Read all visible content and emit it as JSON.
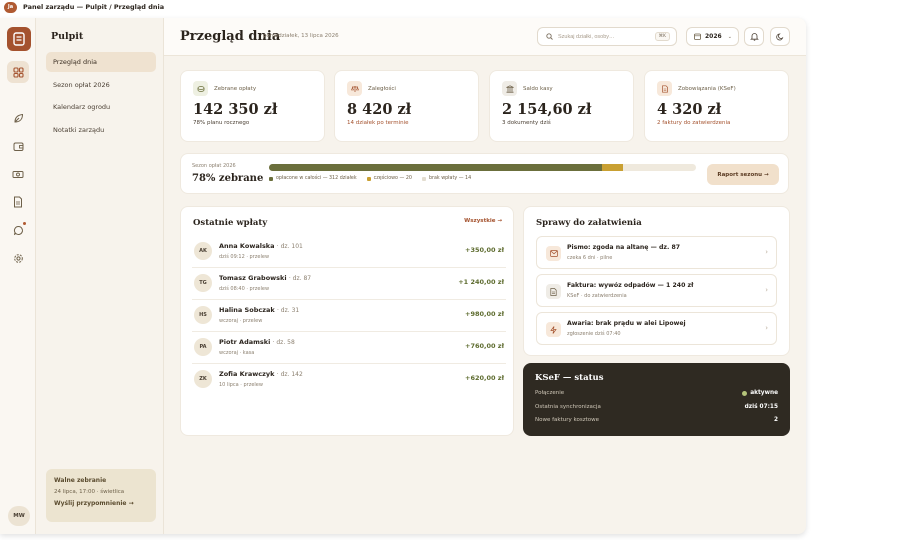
{
  "window": {
    "avatar": "Ja",
    "title": "Panel zarządu — Pulpit / Przegląd dnia"
  },
  "rail": {
    "user_initials": "MW"
  },
  "sidebar": {
    "title": "Pulpit",
    "items": [
      {
        "label": "Przegląd dnia",
        "active": true
      },
      {
        "label": "Sezon opłat 2026",
        "active": false
      },
      {
        "label": "Kalendarz ogrodu",
        "active": false
      },
      {
        "label": "Notatki zarządu",
        "active": false
      }
    ],
    "card": {
      "title": "Walne zebranie",
      "subtitle": "24 lipca, 17:00 · świetlica",
      "action": "Wyślij przypomnienie →"
    }
  },
  "header": {
    "title": "Przegląd dnia",
    "date": "poniedziałek, 13 lipca 2026",
    "search_placeholder": "Szukaj działki, osoby…",
    "search_kbd": "⌘K",
    "year": "2026"
  },
  "kpis": [
    {
      "label": "Zebrane opłaty",
      "value": "142 350 zł",
      "sub": "78% planu rocznego",
      "warn": false,
      "icon": "coins-icon",
      "icon_bg": "#eef0e2",
      "icon_color": "#6b6f3c"
    },
    {
      "label": "Zaległości",
      "value": "8 420 zł",
      "sub": "14 działek po terminie",
      "warn": true,
      "icon": "scale-icon",
      "icon_bg": "#f7e8da",
      "icon_color": "#a4522e"
    },
    {
      "label": "Saldo kasy",
      "value": "2 154,60 zł",
      "sub": "3 dokumenty dziś",
      "warn": false,
      "icon": "bank-icon",
      "icon_bg": "#efece6",
      "icon_color": "#6d6049"
    },
    {
      "label": "Zobowiązania (KSeF)",
      "value": "4 320 zł",
      "sub": "2 faktury do zatwierdzenia",
      "warn": true,
      "icon": "invoice-icon",
      "icon_bg": "#f7e8da",
      "icon_color": "#a4522e"
    }
  ],
  "season": {
    "label": "Sezon opłat 2026",
    "headline": "78% zebrane",
    "paid_fraction": 0.78,
    "partial_fraction": 0.05,
    "legend": [
      {
        "label": "opłacone w całości — 312 działek",
        "color": "#6b6f3c"
      },
      {
        "label": "częściowo — 20",
        "color": "#c9a032"
      },
      {
        "label": "brak wpłaty — 14",
        "color": "#e3ddd0"
      }
    ],
    "button": "Raport sezonu →"
  },
  "payments": {
    "title": "Ostatnie wpłaty",
    "link": "Wszystkie →",
    "rows": [
      {
        "initials": "AK",
        "name": "Anna Kowalska",
        "plot": "· dz. 101",
        "meta": "dziś 09:12 · przelew",
        "amount": "+350,00 zł"
      },
      {
        "initials": "TG",
        "name": "Tomasz Grabowski",
        "plot": "· dz. 87",
        "meta": "dziś 08:40 · przelew",
        "amount": "+1 240,00 zł"
      },
      {
        "initials": "HS",
        "name": "Halina Sobczak",
        "plot": "· dz. 31",
        "meta": "wczoraj · przelew",
        "amount": "+980,00 zł"
      },
      {
        "initials": "PA",
        "name": "Piotr Adamski",
        "plot": "· dz. 58",
        "meta": "wczoraj · kasa",
        "amount": "+760,00 zł"
      },
      {
        "initials": "ZK",
        "name": "Zofia Krawczyk",
        "plot": "· dz. 142",
        "meta": "10 lipca · przelew",
        "amount": "+620,00 zł"
      }
    ]
  },
  "tasks": {
    "title": "Sprawy do załatwienia",
    "rows": [
      {
        "title": "Pismo: zgoda na altanę — dz. 87",
        "sub": "czeka 6 dni · pilne",
        "icon": "letter-icon"
      },
      {
        "title": "Faktura: wywóz odpadów — 1 240 zł",
        "sub": "KSeF · do zatwierdzenia",
        "icon": "document-icon"
      },
      {
        "title": "Awaria: brak prądu w alei Lipowej",
        "sub": "zgłoszenie dziś 07:40",
        "icon": "lightning-icon"
      }
    ]
  },
  "ksef": {
    "title": "KSeF — status",
    "rows": [
      {
        "label": "Połączenie",
        "value": "aktywne",
        "dot": true
      },
      {
        "label": "Ostatnia synchronizacja",
        "value": "dziś 07:15",
        "dot": false
      },
      {
        "label": "Nowe faktury kosztowe",
        "value": "2",
        "dot": false
      }
    ]
  }
}
